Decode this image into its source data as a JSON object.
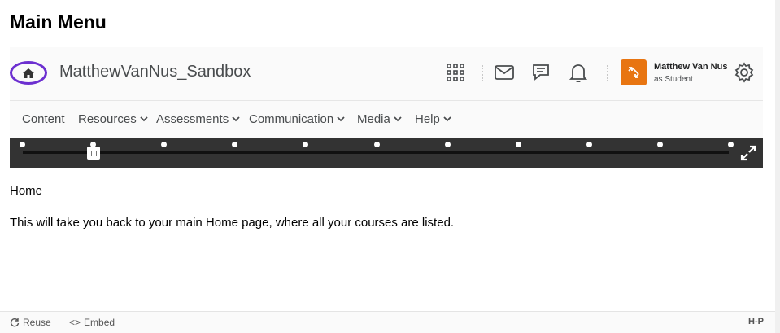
{
  "page": {
    "title": "Main Menu"
  },
  "brightspace": {
    "org_name": "MatthewVanNus_Sandbox",
    "user": {
      "name": "Matthew Van Nus",
      "role": "as Student"
    },
    "accent_color": "#6c2fd0",
    "avatar_color": "#e87511",
    "toolbar_icons": [
      "waffle-icon",
      "mail-icon",
      "chat-icon",
      "bell-icon",
      "gear-icon"
    ],
    "nav": [
      {
        "label": "Content",
        "dropdown": false
      },
      {
        "label": "Resources",
        "dropdown": true
      },
      {
        "label": "Assessments",
        "dropdown": true
      },
      {
        "label": "Communication",
        "dropdown": true
      },
      {
        "label": "Media",
        "dropdown": true
      },
      {
        "label": "Help",
        "dropdown": true
      }
    ]
  },
  "timeline": {
    "steps": 11,
    "current_step": 1
  },
  "content": {
    "heading": "Home",
    "description": "This will take you back to your main Home page, where all your courses are listed."
  },
  "footer": {
    "reuse": "Reuse",
    "embed": "Embed",
    "brand": "H-P"
  }
}
